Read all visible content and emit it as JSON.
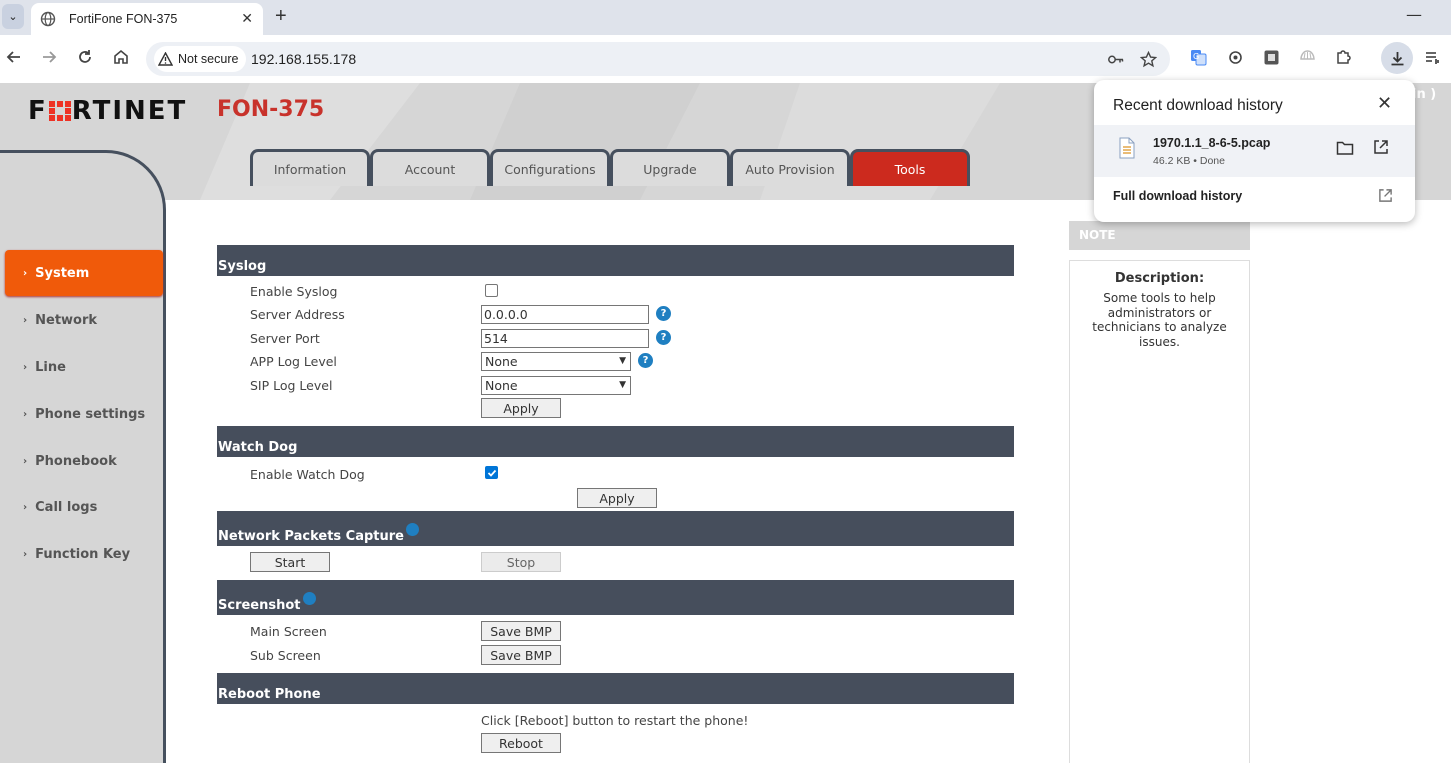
{
  "browser": {
    "tab_title": "FortiFone FON-375",
    "security_label": "Not secure",
    "url": "192.168.155.178"
  },
  "download_popup": {
    "title": "Recent download history",
    "file_name": "1970.1.1_8-6-5.pcap",
    "file_meta": "46.2 KB • Done",
    "full_history": "Full download history"
  },
  "header": {
    "brand": "FRTINET",
    "model": "FON-375",
    "login_fragment": "in )"
  },
  "main_tabs": [
    "Information",
    "Account",
    "Configurations",
    "Upgrade",
    "Auto Provision",
    "Tools"
  ],
  "sidebar": [
    "System",
    "Network",
    "Line",
    "Phone settings",
    "Phonebook",
    "Call logs",
    "Function Key"
  ],
  "syslog": {
    "heading": "Syslog",
    "enable_label": "Enable Syslog",
    "server_address_label": "Server Address",
    "server_address_value": "0.0.0.0",
    "server_port_label": "Server Port",
    "server_port_value": "514",
    "app_log_label": "APP Log Level",
    "app_log_value": "None",
    "sip_log_label": "SIP Log Level",
    "sip_log_value": "None",
    "apply": "Apply"
  },
  "watchdog": {
    "heading": "Watch Dog",
    "enable_label": "Enable Watch Dog",
    "apply": "Apply"
  },
  "capture": {
    "heading": "Network Packets Capture",
    "start": "Start",
    "stop": "Stop"
  },
  "screenshot": {
    "heading": "Screenshot",
    "main_label": "Main Screen",
    "sub_label": "Sub Screen",
    "save": "Save BMP"
  },
  "reboot": {
    "heading": "Reboot Phone",
    "text": "Click [Reboot] button to restart the phone!",
    "button": "Reboot"
  },
  "note": {
    "heading": "NOTE",
    "title": "Description:",
    "body": "Some tools to help administrators or technicians to analyze issues."
  }
}
